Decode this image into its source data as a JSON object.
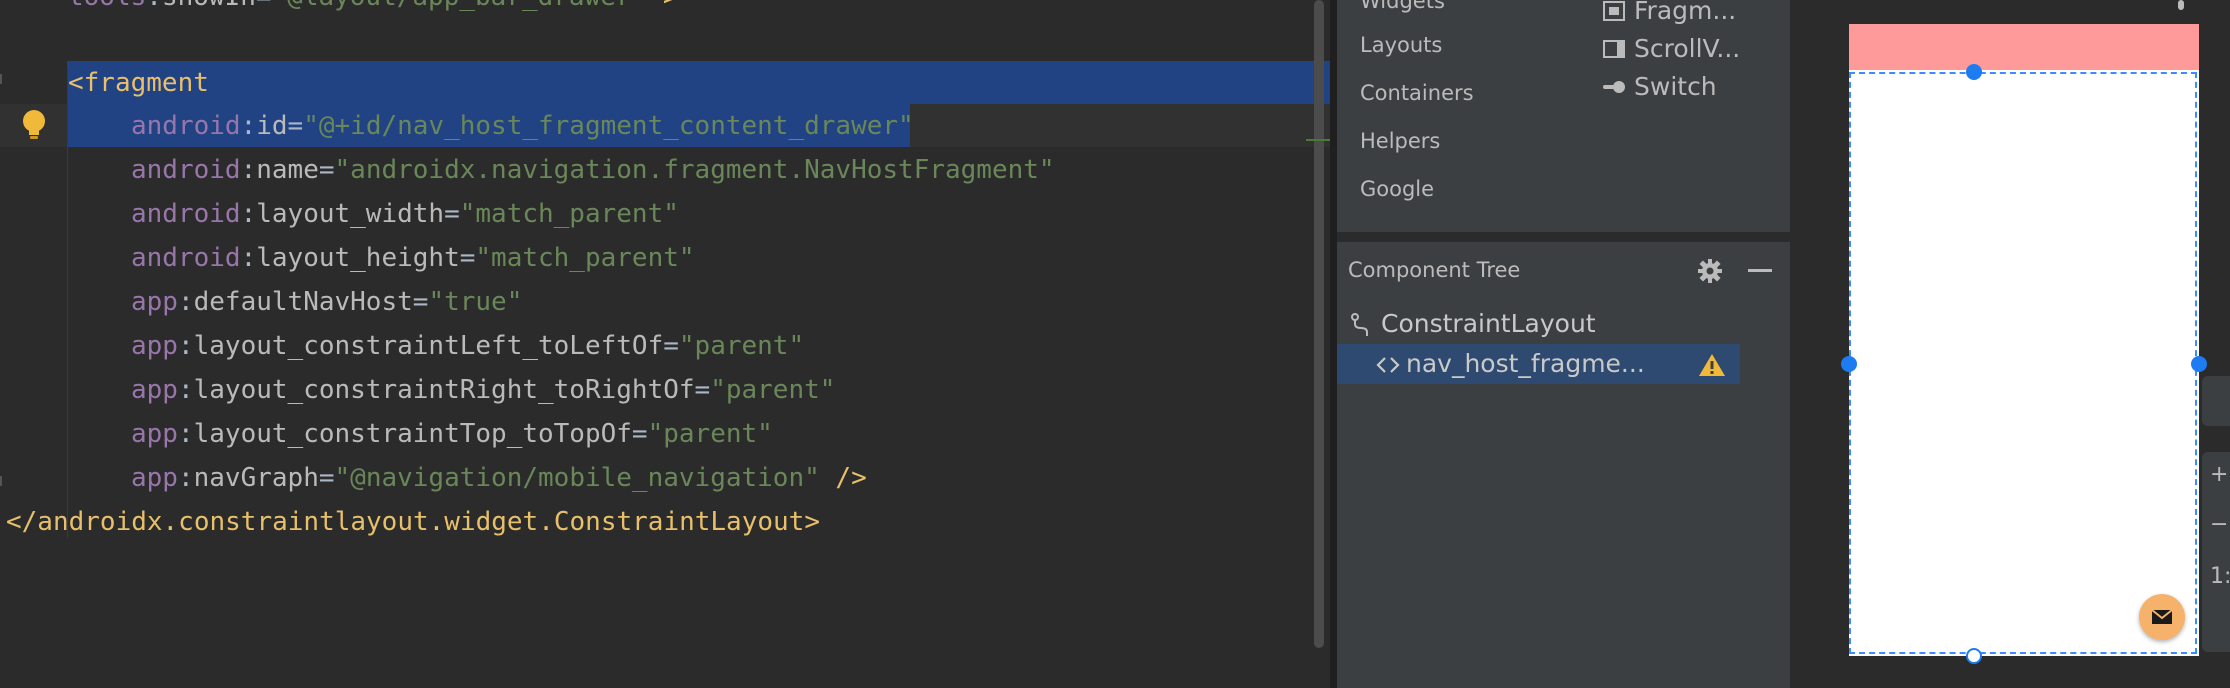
{
  "editor": {
    "top_partial": {
      "ns": "tools",
      "attr": "showIn",
      "val": "\"@layout/app_bar_drawer\"",
      "suffix": " >"
    },
    "fragment_open": "<fragment",
    "lines": [
      {
        "ns": "android",
        "attr": "id",
        "val": "\"@+id/nav_host_fragment_content_drawer\""
      },
      {
        "ns": "android",
        "attr": "name",
        "val": "\"androidx.navigation.fragment.NavHostFragment\""
      },
      {
        "ns": "android",
        "attr": "layout_width",
        "val": "\"match_parent\""
      },
      {
        "ns": "android",
        "attr": "layout_height",
        "val": "\"match_parent\""
      },
      {
        "ns": "app",
        "attr": "defaultNavHost",
        "val": "\"true\""
      },
      {
        "ns": "app",
        "attr": "layout_constraintLeft_toLeftOf",
        "val": "\"parent\""
      },
      {
        "ns": "app",
        "attr": "layout_constraintRight_toRightOf",
        "val": "\"parent\""
      },
      {
        "ns": "app",
        "attr": "layout_constraintTop_toTopOf",
        "val": "\"parent\""
      },
      {
        "ns": "app",
        "attr": "navGraph",
        "val": "\"@navigation/mobile_navigation\"",
        "suffix": " />"
      }
    ],
    "closing_tag": "</androidx.constraintlayout.widget.ConstraintLayout>"
  },
  "palette": {
    "categories": [
      "Widgets",
      "Layouts",
      "Containers",
      "Helpers",
      "Google"
    ],
    "items": [
      {
        "label": "Fragm...",
        "icon": "fragment-icon"
      },
      {
        "label": "ScrollV...",
        "icon": "scrollview-icon"
      },
      {
        "label": "Switch",
        "icon": "switch-icon"
      }
    ]
  },
  "component_tree": {
    "title": "Component Tree",
    "rows": [
      {
        "label": "ConstraintLayout",
        "icon": "constraint-layout-icon"
      },
      {
        "label": "nav_host_fragme...",
        "icon": "code-brackets-icon",
        "warning": true
      }
    ]
  },
  "design": {
    "appbar_color": "#ff9a9a",
    "fab_color": "#f6b26b",
    "selection_color": "#1e7cf2",
    "zoom_labels": [
      "+",
      "−",
      "1:"
    ]
  },
  "colors": {
    "editor_bg": "#2b2b2b",
    "selection": "#214283",
    "tag": "#e8bf6a",
    "namespace": "#9876aa",
    "string": "#6a8759"
  }
}
